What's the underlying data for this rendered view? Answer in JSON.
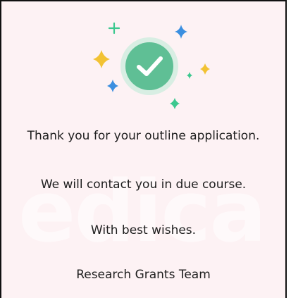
{
  "dialog": {
    "watermark_text": "edica",
    "success_icon": "check-circle-icon",
    "message_line1": "Thank you for your outline application.",
    "message_line2": "We will contact you in due course.",
    "message_line3": "With best wishes.",
    "signature": "Research Grants Team"
  },
  "colors": {
    "background": "#fdf2f4",
    "check_circle": "#5fbf95",
    "check_ring": "#d8eee3",
    "sparkle_green": "#3cc88f",
    "sparkle_blue": "#3b8fe0",
    "sparkle_yellow": "#f2c233"
  }
}
